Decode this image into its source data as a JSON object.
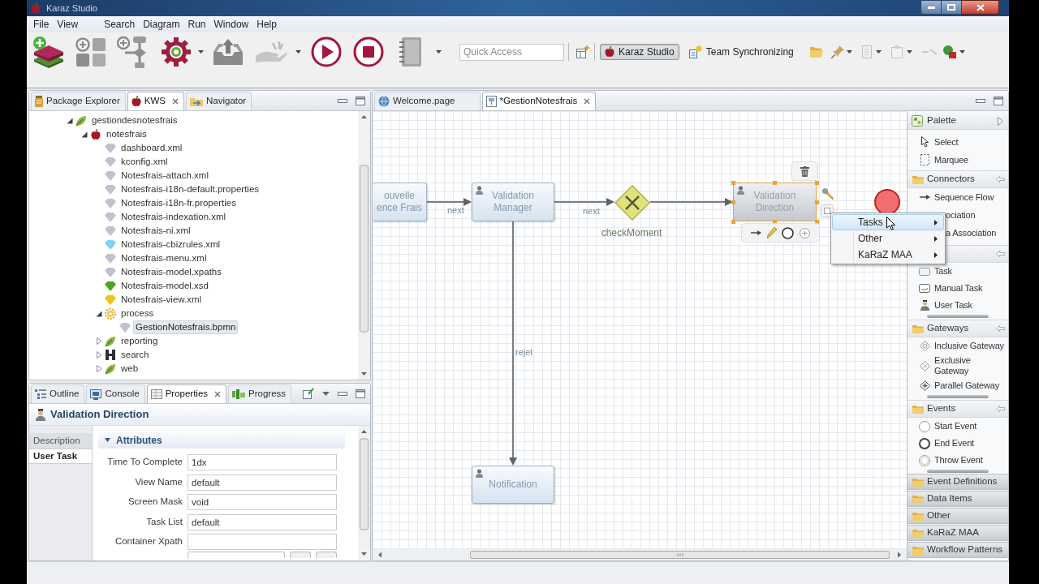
{
  "window": {
    "title": "Karaz Studio"
  },
  "menu_bar": [
    "File",
    "View",
    "Search",
    "Diagram",
    "Run",
    "Window",
    "Help"
  ],
  "toolbar": {
    "quick_access": {
      "placeholder": "Quick Access"
    },
    "perspectives": [
      {
        "label": "Karaz Studio",
        "selected": true
      },
      {
        "label": "Team Synchronizing",
        "selected": false
      }
    ]
  },
  "explorer": {
    "tabs": [
      {
        "label": "Package Explorer",
        "selected": false
      },
      {
        "label": "KWS",
        "selected": true
      },
      {
        "label": "Navigator",
        "selected": false
      }
    ],
    "tree": [
      {
        "label": "gestiondesnotesfrais",
        "kind": "project",
        "expanded": true,
        "selected": false,
        "children": [
          {
            "label": "notesfrais",
            "kind": "module",
            "expanded": true,
            "selected": false,
            "children": [
              {
                "label": "dashboard.xml",
                "kind": "file",
                "color": "#bfc2d0",
                "selected": false
              },
              {
                "label": "kconfig.xml",
                "kind": "file",
                "color": "#bfc2d0",
                "selected": false
              },
              {
                "label": "Notesfrais-attach.xml",
                "kind": "file",
                "color": "#bfc2d0",
                "selected": false
              },
              {
                "label": "Notesfrais-i18n-default.properties",
                "kind": "file",
                "color": "#bfc2d0",
                "selected": false
              },
              {
                "label": "Notesfrais-i18n-fr.properties",
                "kind": "file",
                "color": "#bfc2d0",
                "selected": false
              },
              {
                "label": "Notesfrais-indexation.xml",
                "kind": "file",
                "color": "#bfc2d0",
                "selected": false
              },
              {
                "label": "Notesfrais-ni.xml",
                "kind": "file",
                "color": "#bfc2d0",
                "selected": false
              },
              {
                "label": "Notesfrais-cbizrules.xml",
                "kind": "file",
                "color": "#7fd3ef",
                "selected": false
              },
              {
                "label": "Notesfrais-menu.xml",
                "kind": "file",
                "color": "#bfc2d0",
                "selected": false
              },
              {
                "label": "Notesfrais-model.xpaths",
                "kind": "file",
                "color": "#bfc2d0",
                "selected": false
              },
              {
                "label": "Notesfrais-model.xsd",
                "kind": "file",
                "color": "#4aa524",
                "selected": false
              },
              {
                "label": "Notesfrais-view.xml",
                "kind": "file",
                "color": "#f0c419",
                "selected": false
              },
              {
                "label": "process",
                "kind": "process",
                "expanded": true,
                "selected": false,
                "children": [
                  {
                    "label": "GestionNotesfrais.bpmn",
                    "kind": "file",
                    "color": "#bfc2d0",
                    "selected": true
                  }
                ]
              },
              {
                "label": "reporting",
                "kind": "project",
                "expanded": false,
                "selected": false
              },
              {
                "label": "search",
                "kind": "search",
                "expanded": false,
                "selected": false
              },
              {
                "label": "web",
                "kind": "project",
                "expanded": false,
                "selected": false
              }
            ]
          }
        ]
      }
    ]
  },
  "properties": {
    "tabs": [
      {
        "label": "Outline",
        "selected": false
      },
      {
        "label": "Console",
        "selected": false
      },
      {
        "label": "Properties",
        "selected": true
      },
      {
        "label": "Progress",
        "selected": false
      }
    ],
    "title": "Validation Direction",
    "side_tabs": [
      {
        "label": "Description",
        "selected": false
      },
      {
        "label": "User Task",
        "selected": true
      }
    ],
    "section": {
      "label": "Attributes",
      "expanded": true,
      "fields": [
        {
          "label": "Time To Complete",
          "value": "1dx"
        },
        {
          "label": "View Name",
          "value": "default"
        },
        {
          "label": "Screen Mask",
          "value": "void"
        },
        {
          "label": "Task List",
          "value": "default"
        },
        {
          "label": "Container Xpath"
        }
      ]
    }
  },
  "editor": {
    "tabs": [
      {
        "label": "Welcome.page",
        "selected": false
      },
      {
        "label": "*GestionNotesfrais",
        "selected": true
      }
    ],
    "diagram": {
      "nodes": [
        {
          "kind": "task",
          "label": "ouvelle\nence Frais",
          "selected": false
        },
        {
          "kind": "task",
          "label": "Validation Manager",
          "selected": false
        },
        {
          "kind": "gateway",
          "label": "checkMoment",
          "selected": false
        },
        {
          "kind": "task",
          "label": "Validation Direction",
          "selected": true
        },
        {
          "kind": "end_event",
          "selected": false
        },
        {
          "kind": "task",
          "label": "Notification",
          "selected": false
        }
      ],
      "edges": [
        {
          "kind": "sequence_flow",
          "label": "next"
        },
        {
          "kind": "sequence_flow",
          "label": "next"
        },
        {
          "kind": "sequence_flow"
        },
        {
          "kind": "sequence_flow",
          "label": "rejet"
        }
      ]
    },
    "context_menu": [
      {
        "label": "Tasks",
        "selected": true
      },
      {
        "label": "Other",
        "selected": false
      },
      {
        "label": "KaRaZ MAA",
        "selected": false
      }
    ]
  },
  "palette": {
    "title": "Palette",
    "tools": [
      {
        "label": "Select",
        "kind": "select"
      },
      {
        "label": "Marquee",
        "kind": "marquee"
      }
    ],
    "drawers": [
      {
        "label": "Connectors",
        "expanded": true,
        "items": [
          {
            "label": "Sequence Flow",
            "kind": "flow"
          },
          {
            "label": "ociation",
            "kind": "covered"
          },
          {
            "label": "a Association",
            "kind": "covered"
          }
        ]
      },
      {
        "expanded": true,
        "items": [
          {
            "label": "Task",
            "kind": "task"
          },
          {
            "label": "Manual Task",
            "kind": "manual_task"
          },
          {
            "label": "User Task",
            "kind": "user_task"
          }
        ]
      },
      {
        "label": "Gateways",
        "expanded": true,
        "items": [
          {
            "label": "Inclusive Gateway",
            "kind": "inclusive"
          },
          {
            "label": "Exclusive Gateway",
            "kind": "exclusive"
          },
          {
            "label": "Parallel Gateway",
            "kind": "parallel"
          }
        ]
      },
      {
        "label": "Events",
        "expanded": true,
        "items": [
          {
            "label": "Start Event",
            "kind": "start"
          },
          {
            "label": "End Event",
            "kind": "end"
          },
          {
            "label": "Throw Event",
            "kind": "throw"
          }
        ]
      },
      {
        "label": "Event Definitions",
        "expanded": false
      },
      {
        "label": "Data Items",
        "expanded": false
      },
      {
        "label": "Other",
        "expanded": false
      },
      {
        "label": "KaRaZ MAA",
        "expanded": false
      },
      {
        "label": "Workflow Patterns",
        "expanded": false
      }
    ]
  }
}
